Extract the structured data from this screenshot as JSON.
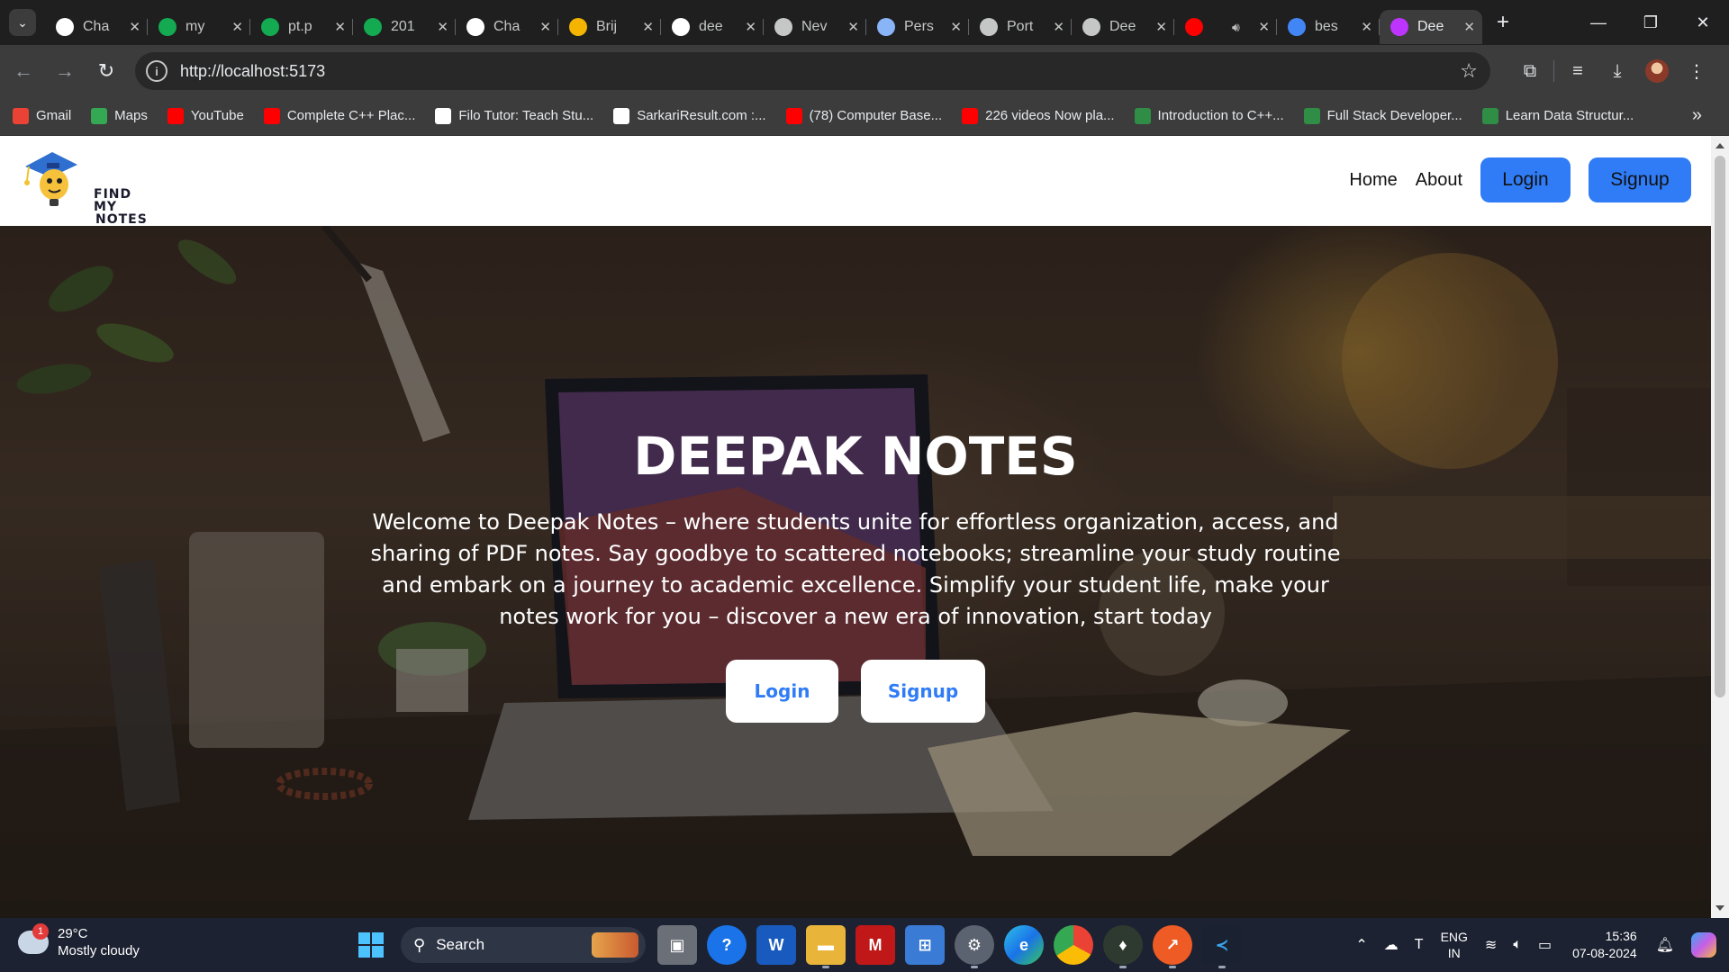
{
  "browser": {
    "tabs": [
      {
        "title": "Cha",
        "icon": "github-icon",
        "color": "#ffffff"
      },
      {
        "title": "my",
        "icon": "mongodb-leaf-icon",
        "color": "#13aa52"
      },
      {
        "title": "pt.p",
        "icon": "mongodb-leaf-icon",
        "color": "#13aa52"
      },
      {
        "title": "201",
        "icon": "mongodb-leaf-icon",
        "color": "#13aa52"
      },
      {
        "title": "Cha",
        "icon": "chatgpt-icon",
        "color": "#ffffff"
      },
      {
        "title": "Brij",
        "icon": "google-drive-icon",
        "color": "#f4b400"
      },
      {
        "title": "dee",
        "icon": "github-icon",
        "color": "#ffffff"
      },
      {
        "title": "Nev",
        "icon": "chrome-icon",
        "color": "#c4c7c5"
      },
      {
        "title": "Pers",
        "icon": "person-icon",
        "color": "#8ab4f8"
      },
      {
        "title": "Port",
        "icon": "globe-icon",
        "color": "#c4c7c5"
      },
      {
        "title": "Dee",
        "icon": "globe-icon",
        "color": "#c4c7c5"
      },
      {
        "title": "",
        "icon": "youtube-icon",
        "color": "#ff0000",
        "audio": true
      },
      {
        "title": "bes",
        "icon": "google-icon",
        "color": "#4285f4"
      },
      {
        "title": "Dee",
        "icon": "vite-icon",
        "color": "#bd34fe",
        "active": true
      }
    ],
    "new_tab_label": "+",
    "address": "http://localhost:5173",
    "bookmarks": [
      {
        "label": "Gmail",
        "icon": "gmail-icon",
        "color": "#ea4335"
      },
      {
        "label": "Maps",
        "icon": "maps-icon",
        "color": "#34a853"
      },
      {
        "label": "YouTube",
        "icon": "youtube-icon",
        "color": "#ff0000"
      },
      {
        "label": "Complete C++ Plac...",
        "icon": "youtube-icon",
        "color": "#ff0000"
      },
      {
        "label": "Filo Tutor: Teach Stu...",
        "icon": "filo-icon",
        "color": "#ffffff"
      },
      {
        "label": "SarkariResult.com :...",
        "icon": "sarkari-icon",
        "color": "#ffffff"
      },
      {
        "label": "(78) Computer Base...",
        "icon": "youtube-icon",
        "color": "#ff0000"
      },
      {
        "label": "226 videos Now pla...",
        "icon": "youtube-icon",
        "color": "#ff0000"
      },
      {
        "label": "Introduction to C++...",
        "icon": "gfg-icon",
        "color": "#2f8d46"
      },
      {
        "label": "Full Stack Developer...",
        "icon": "gfg-icon",
        "color": "#2f8d46"
      },
      {
        "label": "Learn Data Structur...",
        "icon": "gfg-icon",
        "color": "#2f8d46"
      }
    ]
  },
  "site": {
    "logo_text_line1": "FIND MY",
    "logo_text_line2": "NOTES",
    "nav": {
      "home": "Home",
      "about": "About",
      "login": "Login",
      "signup": "Signup"
    },
    "hero": {
      "title": "DEEPAK NOTES",
      "description": "Welcome to Deepak Notes – where students unite for effortless organization, access, and sharing of PDF notes. Say goodbye to scattered notebooks; streamline your study routine and embark on a journey to academic excellence. Simplify your student life, make your notes work for you – discover a new era of innovation, start today",
      "login": "Login",
      "signup": "Signup"
    },
    "colors": {
      "accent": "#2f7cf6"
    }
  },
  "taskbar": {
    "weather_temp": "29°C",
    "weather_desc": "Mostly cloudy",
    "weather_badge": "1",
    "search_label": "Search",
    "language_line1": "ENG",
    "language_line2": "IN",
    "time": "15:36",
    "date": "07-08-2024"
  }
}
